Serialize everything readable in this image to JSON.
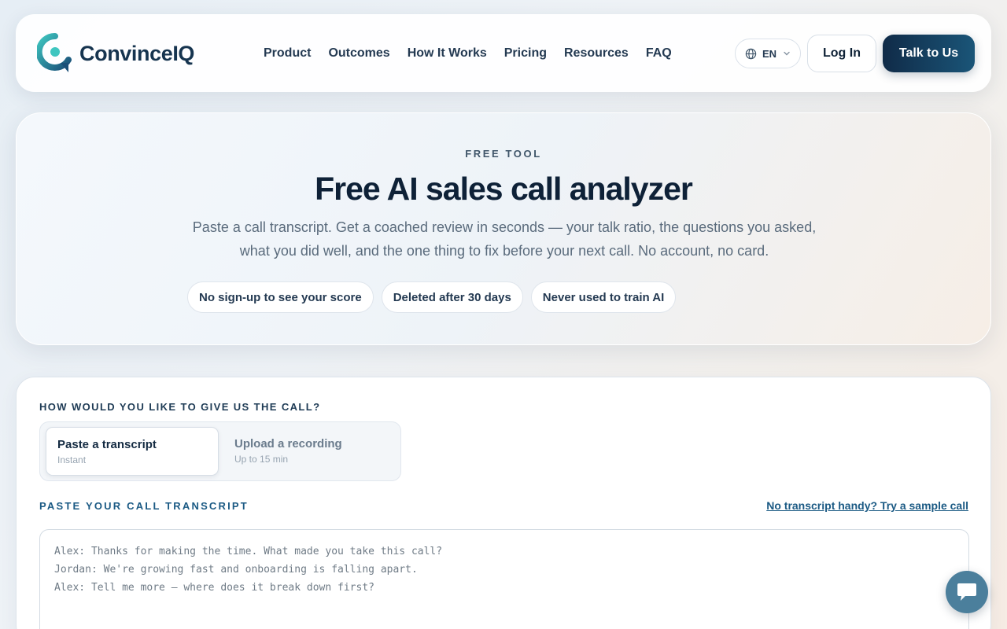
{
  "brand": {
    "name": "ConvinceIQ"
  },
  "nav": {
    "items": [
      "Product",
      "Outcomes",
      "How It Works",
      "Pricing",
      "Resources",
      "FAQ"
    ]
  },
  "header": {
    "language": "EN",
    "login_label": "Log In",
    "cta_label": "Talk to Us"
  },
  "hero": {
    "eyebrow": "FREE TOOL",
    "title": "Free AI sales call analyzer",
    "subtitle": "Paste a call transcript. Get a coached review in seconds — your talk ratio, the questions you asked, what you did well, and the one thing to fix before your next call. No account, no card.",
    "chips": [
      "No sign-up to see your score",
      "Deleted after 30 days",
      "Never used to train AI"
    ]
  },
  "input_card": {
    "question": "HOW WOULD YOU LIKE TO GIVE US THE CALL?",
    "options": [
      {
        "title": "Paste a transcript",
        "subtitle": "Instant",
        "selected": true
      },
      {
        "title": "Upload a recording",
        "subtitle": "Up to 15 min",
        "selected": false
      }
    ],
    "paste_label": "PASTE YOUR CALL TRANSCRIPT",
    "sample_link": "No transcript handy? Try a sample call",
    "placeholder": "Alex: Thanks for making the time. What made you take this call?\nJordan: We're growing fast and onboarding is falling apart.\nAlex: Tell me more — where does it break down first?"
  },
  "icons": {
    "logo": "logo-icon",
    "language": "globe-icon",
    "dropdown": "chevron-down-icon",
    "chat": "chat-icon"
  },
  "colors": {
    "brand_dark": "#102b48",
    "brand_accent": "#1b5a84",
    "logo_teal": "#3ec6c0"
  }
}
